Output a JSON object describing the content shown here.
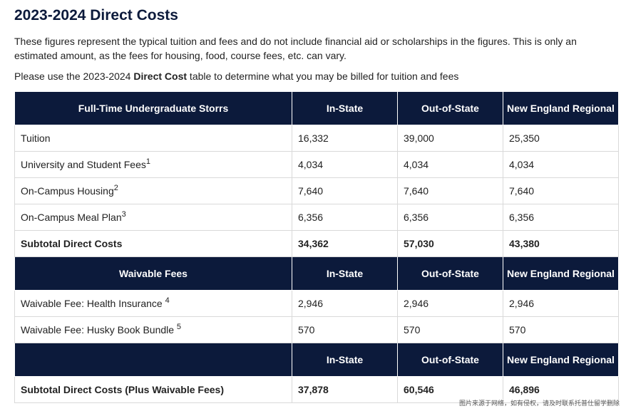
{
  "title": "2023-2024 Direct Costs",
  "intro": "These figures represent the typical tuition and fees and do not include financial aid or scholarships in the figures. This is only an estimated amount, as the fees for housing, food, course fees, etc. can vary.",
  "lead": {
    "before": "Please use the 2023-2024 ",
    "bold": "Direct Cost",
    "after": " table to determine what you may be billed for tuition and fees"
  },
  "table": {
    "header1": [
      "Full-Time Undergraduate Storrs",
      "In-State",
      "Out-of-State",
      "New England Regional"
    ],
    "rows1": [
      {
        "label": "Tuition",
        "sup": "",
        "values": [
          "16,332",
          "39,000",
          "25,350"
        ]
      },
      {
        "label": "University and Student Fees",
        "sup": "1",
        "values": [
          "4,034",
          "4,034",
          "4,034"
        ]
      },
      {
        "label": "On-Campus Housing",
        "sup": "2",
        "values": [
          "7,640",
          "7,640",
          "7,640"
        ]
      },
      {
        "label": "On-Campus Meal Plan",
        "sup": "3",
        "values": [
          "6,356",
          "6,356",
          "6,356"
        ]
      }
    ],
    "subtotal1": {
      "label": "Subtotal Direct Costs",
      "values": [
        "34,362",
        "57,030",
        "43,380"
      ]
    },
    "header2": [
      "Waivable Fees",
      "In-State",
      "Out-of-State",
      "New England Regional"
    ],
    "rows2": [
      {
        "label": "Waivable Fee: Health Insurance ",
        "sup": "4",
        "values": [
          "2,946",
          "2,946",
          "2,946"
        ]
      },
      {
        "label": "Waivable Fee: Husky Book Bundle ",
        "sup": "5",
        "values": [
          "570",
          "570",
          "570"
        ]
      }
    ],
    "header3": [
      "",
      "In-State",
      "Out-of-State",
      "New England Regional"
    ],
    "subtotal2": {
      "label": "Subtotal Direct Costs (Plus Waivable Fees)",
      "values": [
        "37,878",
        "60,546",
        "46,896"
      ]
    }
  },
  "watermark": "图片来源于网络，如有侵权，请及时联系托普仕留学删除"
}
